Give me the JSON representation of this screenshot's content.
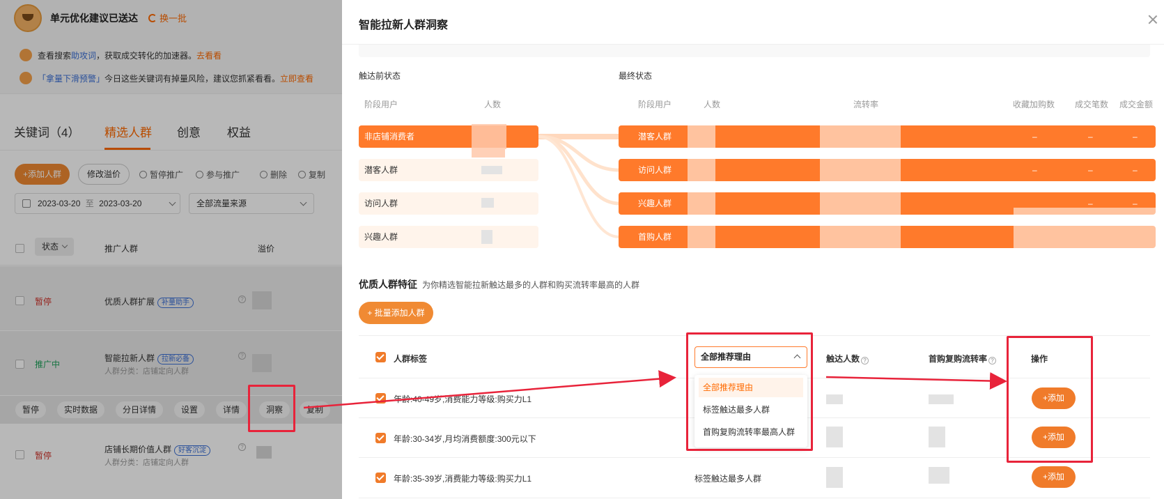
{
  "banner": {
    "title": "单元优化建议已送达",
    "refresh": "换一批",
    "tip1_a": "查看搜索",
    "tip1_b": "助攻词",
    "tip1_c": "，获取成交转化的加速器。",
    "tip1_link": "去看看",
    "tip2_a": "「拿量下滑预警」",
    "tip2_b": "今日这些关键词有掉量风险，建议您抓紧看看。",
    "tip2_link": "立即查看"
  },
  "tabs": [
    "关键词（4）",
    "精选人群",
    "创意",
    "权益"
  ],
  "toolbar": {
    "add": "+添加人群",
    "modify": "修改溢价",
    "pause": "暂停推广",
    "join": "参与推广",
    "delete": "删除",
    "copy": "复制"
  },
  "filters": {
    "date_from": "2023-03-20",
    "date_sep": "至",
    "date_to": "2023-03-20",
    "source": "全部流量来源"
  },
  "left_table": {
    "headers": {
      "status": "状态",
      "crowd": "推广人群",
      "premium": "溢价"
    },
    "rows": [
      {
        "status": "暂停",
        "name": "优质人群扩展",
        "tag": "补量助手",
        "sub": ""
      },
      {
        "status": "推广中",
        "name": "智能拉新人群",
        "tag": "拉新必备",
        "sub": "人群分类：店铺定向人群"
      },
      {
        "status": "暂停",
        "name": "店铺长期价值人群",
        "tag": "好客沉淀",
        "sub": "人群分类：店铺定向人群"
      }
    ],
    "actions": [
      "暂停",
      "实时数据",
      "分日详情",
      "设置",
      "详情",
      "洞察",
      "复制"
    ]
  },
  "drawer": {
    "title": "智能拉新人群洞察",
    "pre_label": "触达前状态",
    "final_label": "最终状态",
    "pre_cols": {
      "stage": "阶段用户",
      "count": "人数"
    },
    "final_cols": {
      "stage": "阶段用户",
      "count": "人数",
      "rate": "流转率",
      "fav": "收藏加购数",
      "orders": "成交笔数",
      "amount": "成交金额"
    },
    "pre_rows": [
      "非店铺消费者",
      "潜客人群",
      "访问人群",
      "兴趣人群"
    ],
    "final_rows": [
      "潜客人群",
      "访问人群",
      "兴趣人群",
      "首购人群"
    ],
    "dash": "–",
    "feature_title": "优质人群特征",
    "feature_desc": "为你精选智能拉新触达最多的人群和购买流转率最高的人群",
    "batch_add": "+ 批量添加人群",
    "table_headers": {
      "label": "人群标签",
      "reach": "触达人数",
      "rate": "首购复购流转率",
      "op": "操作"
    },
    "select_value": "全部推荐理由",
    "options": [
      "全部推荐理由",
      "标签触达最多人群",
      "首购复购流转率最高人群"
    ],
    "rows": [
      {
        "label": "年龄:40-49岁,消费能力等级:购买力L1",
        "reason": ""
      },
      {
        "label": "年龄:30-34岁,月均消费额度:300元以下",
        "reason": ""
      },
      {
        "label": "年龄:35-39岁,消费能力等级:购买力L1",
        "reason": "标签触达最多人群"
      }
    ],
    "add": "+添加"
  },
  "colors": {
    "accent": "#ff7a2b",
    "annotation": "#e8233a"
  }
}
